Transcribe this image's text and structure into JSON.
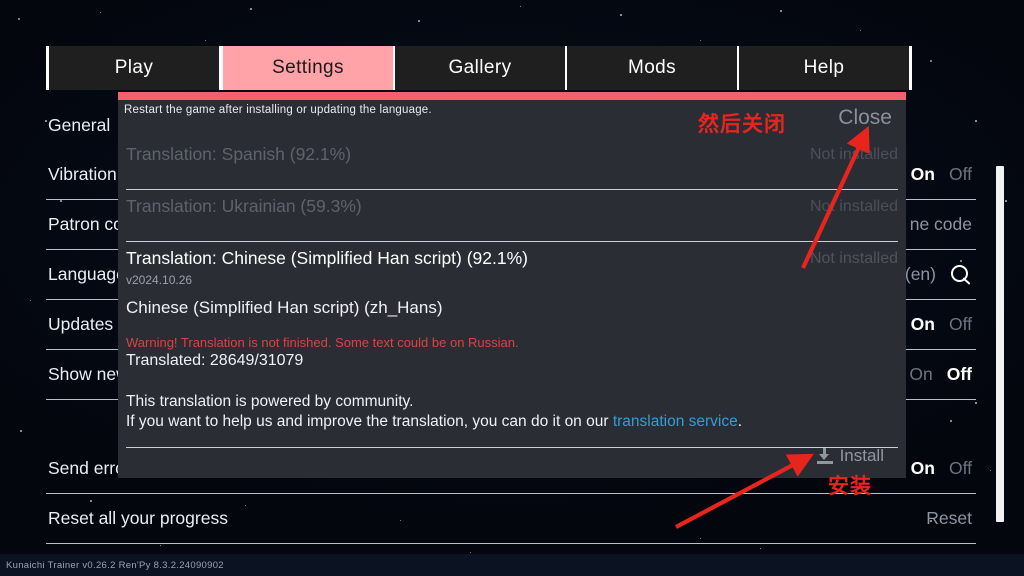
{
  "tabs": [
    {
      "label": "Play",
      "active": false
    },
    {
      "label": "Settings",
      "active": true
    },
    {
      "label": "Gallery",
      "active": false
    },
    {
      "label": "Mods",
      "active": false
    },
    {
      "label": "Help",
      "active": false
    }
  ],
  "settings_rows": [
    {
      "label": "General",
      "right_type": "none",
      "value": ""
    },
    {
      "label": "Vibration",
      "right_type": "onoff",
      "selected": "On",
      "on": "On",
      "off": "Off"
    },
    {
      "label": "Patron code",
      "right_type": "text",
      "value": "ne code"
    },
    {
      "label": "Language",
      "right_type": "search",
      "value": "(en)",
      "icon": "search-icon"
    },
    {
      "label": "Updates",
      "right_type": "onoff",
      "selected": "On",
      "on": "On",
      "off": "Off"
    },
    {
      "label": "Show new",
      "right_type": "onoff",
      "selected": "Off",
      "on": "On",
      "off": "Off"
    },
    {
      "label": "Send error",
      "right_type": "onoff",
      "selected": "On",
      "on": "On",
      "off": "Off"
    },
    {
      "label": "Reset all your progress",
      "right_type": "text",
      "value": "Reset"
    }
  ],
  "dialog": {
    "hint": "Restart the game after installing or updating the language.",
    "close_label": "Close",
    "install_label": "Install",
    "install_icon": "download-icon",
    "languages": [
      {
        "name": "Translation: Spanish (92.1%)",
        "status": "Not installed",
        "state": "dim"
      },
      {
        "name": "Translation: Ukrainian (59.3%)",
        "status": "Not installed",
        "state": "dim"
      }
    ],
    "selected_language": {
      "name": "Translation: Chinese (Simplified Han script) (92.1%)",
      "status": "Not installed",
      "version": "v2024.10.26",
      "full_name": "Chinese (Simplified Han script) (zh_Hans)",
      "warning": "Warning! Translation is not finished. Some text could be on Russian.",
      "translated": "Translated: 28649/31079",
      "powered_line1": "This translation is powered by community.",
      "powered_line2_pre": "If you want to help us and improve the translation, you can do it on our ",
      "powered_link": "translation service",
      "powered_line2_post": "."
    }
  },
  "annotations": [
    {
      "text": "然后关闭",
      "name": "annotation-then-close"
    },
    {
      "text": "安装",
      "name": "annotation-install"
    }
  ],
  "version_bar": {
    "text": "Kunaichi Trainer v0.26.2   Ren'Py 8.3.2.24090902"
  },
  "colors": {
    "accent_pink": "#ffa3a8",
    "dialog_topbar": "#f4606c",
    "annotation_red": "#e8251c",
    "link_blue": "#2f9fd6",
    "warning_red": "#d6453f"
  }
}
